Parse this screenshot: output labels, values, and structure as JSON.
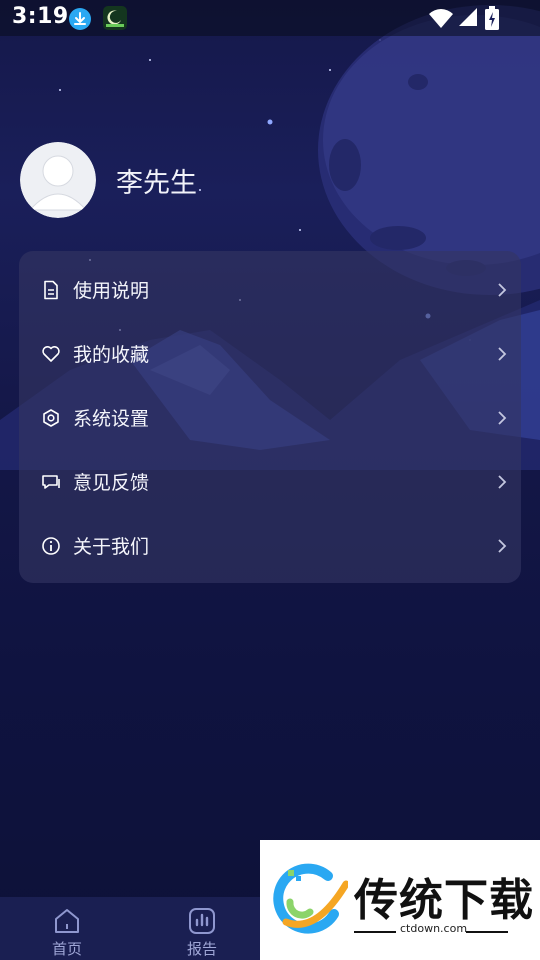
{
  "status_bar": {
    "time": "3:19",
    "icons": [
      "download-icon",
      "app-notification-icon",
      "wifi-icon",
      "cellular-signal-icon",
      "battery-charging-icon"
    ]
  },
  "profile": {
    "name": "李先生",
    "avatar_icon": "default-user-avatar"
  },
  "menu": {
    "items": [
      {
        "label": "使用说明",
        "icon": "document-icon"
      },
      {
        "label": "我的收藏",
        "icon": "heart-icon"
      },
      {
        "label": "系统设置",
        "icon": "settings-icon"
      },
      {
        "label": "意见反馈",
        "icon": "feedback-icon"
      },
      {
        "label": "关于我们",
        "icon": "info-icon"
      }
    ]
  },
  "tabbar": {
    "tabs": [
      {
        "label": "首页",
        "icon": "home-icon"
      },
      {
        "label": "报告",
        "icon": "report-chart-icon"
      }
    ]
  },
  "watermark": {
    "title": "传统下载",
    "url": "ctdown.com"
  },
  "colors": {
    "background": "#141747",
    "card": "#343662",
    "tabbar": "#1a1f52",
    "accent_blue": "#2aa8f2",
    "tab_inactive": "#9fa6d6"
  }
}
